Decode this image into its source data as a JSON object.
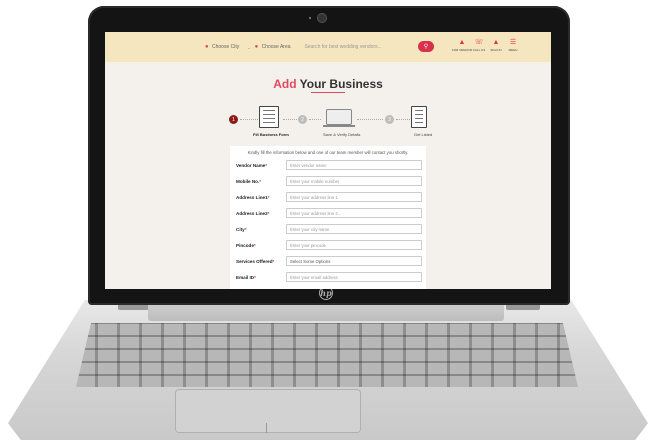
{
  "header": {
    "city_label": "Choose City",
    "area_label": "Choose Area",
    "search_placeholder": "Search for best wedding vendors...",
    "nav": [
      {
        "label": "FOR VENDOR",
        "icon": "user-icon"
      },
      {
        "label": "CALL US",
        "icon": "phone-icon"
      },
      {
        "label": "SIGN IN",
        "icon": "sign-in-icon"
      },
      {
        "label": "MENU",
        "icon": "menu-icon"
      }
    ]
  },
  "page": {
    "title_accent": "Add",
    "title_rest": "Your Business"
  },
  "stepper": {
    "steps": [
      {
        "number": "1",
        "label": "Fill Business Form",
        "active": true
      },
      {
        "number": "2",
        "label": "Save & Verify Details",
        "active": false
      },
      {
        "number": "3",
        "label": "Get Listed",
        "active": false
      }
    ]
  },
  "form": {
    "intro": "Kindly fill the information below and one of our team member will contact you shortly.",
    "fields": [
      {
        "label": "Vendor Name",
        "placeholder": "Enter vendor name"
      },
      {
        "label": "Mobile No.",
        "placeholder": "Enter your mobile number"
      },
      {
        "label": "Address Line1",
        "placeholder": "Enter your address line 1"
      },
      {
        "label": "Address Line2",
        "placeholder": "Enter your address line 2..."
      },
      {
        "label": "City",
        "placeholder": "Enter your city name"
      },
      {
        "label": "Pincode",
        "placeholder": "Enter your pincode"
      },
      {
        "label": "Services Offered",
        "placeholder": "Select Some Options"
      },
      {
        "label": "Email ID",
        "placeholder": "Enter your email address"
      }
    ],
    "required_mark": "*"
  },
  "colors": {
    "accent": "#d9304c",
    "header_bg": "#f5e6bf",
    "step_active": "#8b1a1a"
  }
}
